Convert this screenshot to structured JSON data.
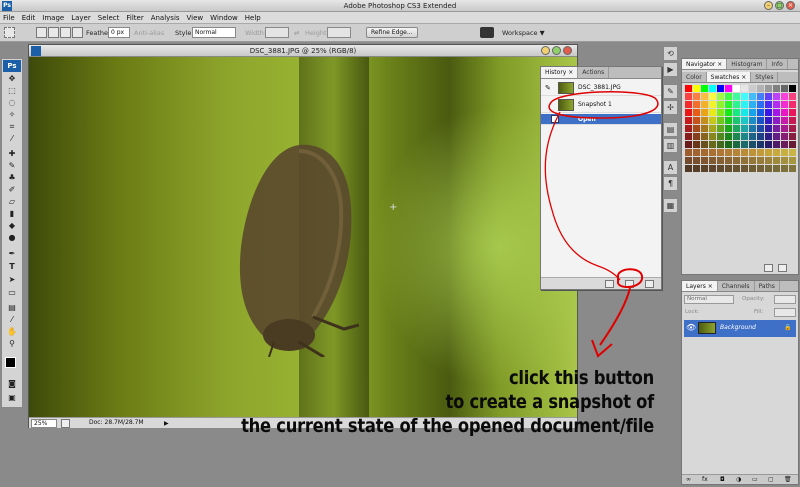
{
  "app": {
    "title": "Adobe Photoshop CS3 Extended",
    "logo": "Ps"
  },
  "menu": [
    "File",
    "Edit",
    "Image",
    "Layer",
    "Select",
    "Filter",
    "Analysis",
    "View",
    "Window",
    "Help"
  ],
  "options": {
    "feather_label": "Feather:",
    "feather_value": "0 px",
    "antialias_label": "Anti-alias",
    "style_label": "Style:",
    "style_value": "Normal",
    "width_label": "Width:",
    "height_label": "Height:",
    "refine_label": "Refine Edge...",
    "workspace_label": "Workspace ▼"
  },
  "document": {
    "title": "DSC_3881.JPG @ 25% (RGB/8)",
    "zoom": "25%",
    "doc_info": "Doc: 28.7M/28.7M"
  },
  "history": {
    "tabs": [
      "History ×",
      "Actions"
    ],
    "rows": [
      {
        "label": "DSC_3881.JPG"
      },
      {
        "label": "Snapshot 1"
      },
      {
        "label": "Open"
      }
    ]
  },
  "swatches": {
    "tabs_top": [
      "Navigator ×",
      "Histogram",
      "Info"
    ],
    "tabs_bottom": [
      "Color",
      "Swatches ×",
      "Styles"
    ]
  },
  "layers": {
    "tabs": [
      "Layers ×",
      "Channels",
      "Paths"
    ],
    "blend_mode": "Normal",
    "opacity_label": "Opacity:",
    "lock_label": "Lock:",
    "fill_label": "Fill:",
    "layer_name": "Background"
  },
  "annotation": {
    "line1": "click this button",
    "line2": "to create a snapshot of",
    "line3": "the current state of the opened document/file",
    "color": "#e00000"
  }
}
